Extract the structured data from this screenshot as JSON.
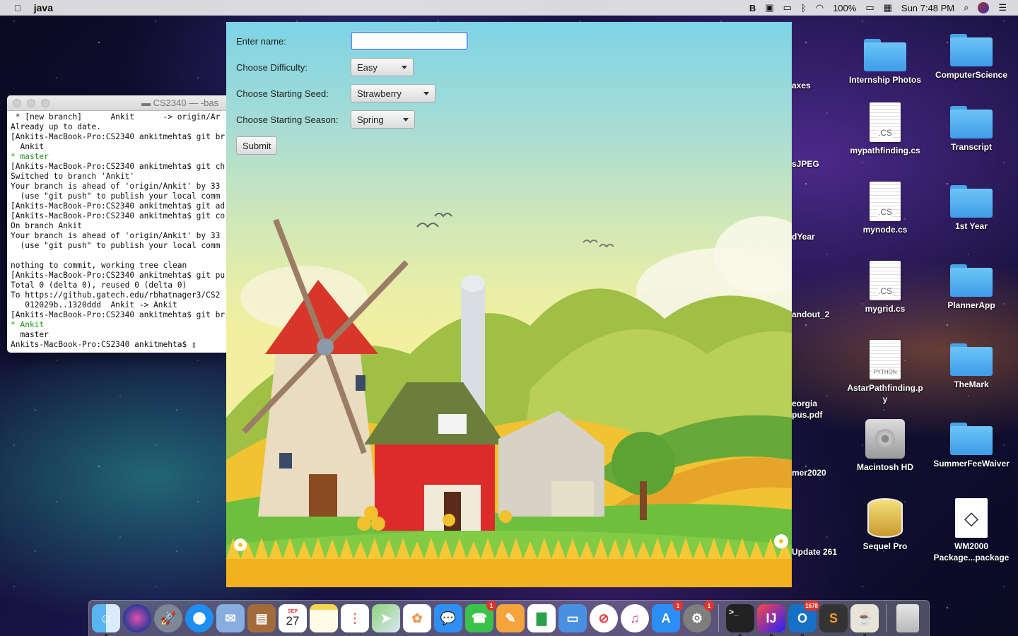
{
  "menubar": {
    "app_name": "java",
    "clock": "Sun 7:48 PM",
    "battery": "100%",
    "icons": [
      "bluetooth-icon",
      "wifi-icon",
      "airplay-icon",
      "spotlight-icon",
      "siri-icon",
      "notification-center-icon"
    ]
  },
  "terminal": {
    "title": "CS2340 — -bas",
    "lines": [
      {
        "text": " * [new branch]      Ankit      -> origin/Ar",
        "green": false
      },
      {
        "text": "Already up to date.",
        "green": false
      },
      {
        "text": "[Ankits-MacBook-Pro:CS2340 ankitmehta$ git br",
        "green": false
      },
      {
        "text": "  Ankit",
        "green": false
      },
      {
        "text": "* master",
        "green": true
      },
      {
        "text": "[Ankits-MacBook-Pro:CS2340 ankitmehta$ git ch",
        "green": false
      },
      {
        "text": "Switched to branch 'Ankit'",
        "green": false
      },
      {
        "text": "Your branch is ahead of 'origin/Ankit' by 33",
        "green": false
      },
      {
        "text": "  (use \"git push\" to publish your local comm",
        "green": false
      },
      {
        "text": "[Ankits-MacBook-Pro:CS2340 ankitmehta$ git ad",
        "green": false
      },
      {
        "text": "[Ankits-MacBook-Pro:CS2340 ankitmehta$ git co",
        "green": false
      },
      {
        "text": "On branch Ankit",
        "green": false
      },
      {
        "text": "Your branch is ahead of 'origin/Ankit' by 33",
        "green": false
      },
      {
        "text": "  (use \"git push\" to publish your local comm",
        "green": false
      },
      {
        "text": "",
        "green": false
      },
      {
        "text": "nothing to commit, working tree clean",
        "green": false
      },
      {
        "text": "[Ankits-MacBook-Pro:CS2340 ankitmehta$ git pu",
        "green": false
      },
      {
        "text": "Total 0 (delta 0), reused 0 (delta 0)",
        "green": false
      },
      {
        "text": "To https://github.gatech.edu/rbhatnager3/CS2",
        "green": false
      },
      {
        "text": "   012029b..1320ddd  Ankit -> Ankit",
        "green": false
      },
      {
        "text": "[Ankits-MacBook-Pro:CS2340 ankitmehta$ git br",
        "green": false
      },
      {
        "text": "* Ankit",
        "green": true
      },
      {
        "text": "  master",
        "green": false
      },
      {
        "text": "Ankits-MacBook-Pro:CS2340 ankitmehta$ ▯",
        "green": false
      }
    ]
  },
  "form": {
    "name_label": "Enter name:",
    "name_value": "",
    "difficulty_label": "Choose Difficulty:",
    "difficulty_value": "Easy",
    "seed_label": "Choose Starting Seed:",
    "seed_value": "Strawberry",
    "season_label": "Choose Starting Season:",
    "season_value": "Spring",
    "submit_label": "Submit"
  },
  "desktop": {
    "partial_labels": [
      "axes",
      "sJPEG",
      "dYear",
      "andout_2",
      "eorgia",
      "pus.pdf",
      "mer2020",
      "Update 261"
    ],
    "icons": [
      {
        "label": "Internship Photos",
        "kind": "folder"
      },
      {
        "label": "ComputerScience",
        "kind": "folder"
      },
      {
        "label": "mypathfinding.cs",
        "kind": "doc",
        "ext": ".CS"
      },
      {
        "label": "Transcript",
        "kind": "folder"
      },
      {
        "label": "mynode.cs",
        "kind": "doc",
        "ext": ".CS"
      },
      {
        "label": "1st Year",
        "kind": "folder"
      },
      {
        "label": "mygrid.cs",
        "kind": "doc",
        "ext": ".CS"
      },
      {
        "label": "PlannerApp",
        "kind": "folder"
      },
      {
        "label": "AstarPathfinding.p\ny",
        "kind": "doc",
        "ext": "PYTHON"
      },
      {
        "label": "TheMark",
        "kind": "folder"
      },
      {
        "label": "Macintosh HD",
        "kind": "hdd"
      },
      {
        "label": "SummerFeeWaiver",
        "kind": "folder"
      },
      {
        "label": "Sequel Pro",
        "kind": "sequel"
      },
      {
        "label": "WM2000\nPackage...package",
        "kind": "unity"
      }
    ]
  },
  "dock": {
    "calendar_month": "SEP",
    "calendar_day": "27",
    "facetime_badge": "1",
    "appstore_badge": "1",
    "prefs_badge": "1",
    "outlook_badge": "1678"
  }
}
